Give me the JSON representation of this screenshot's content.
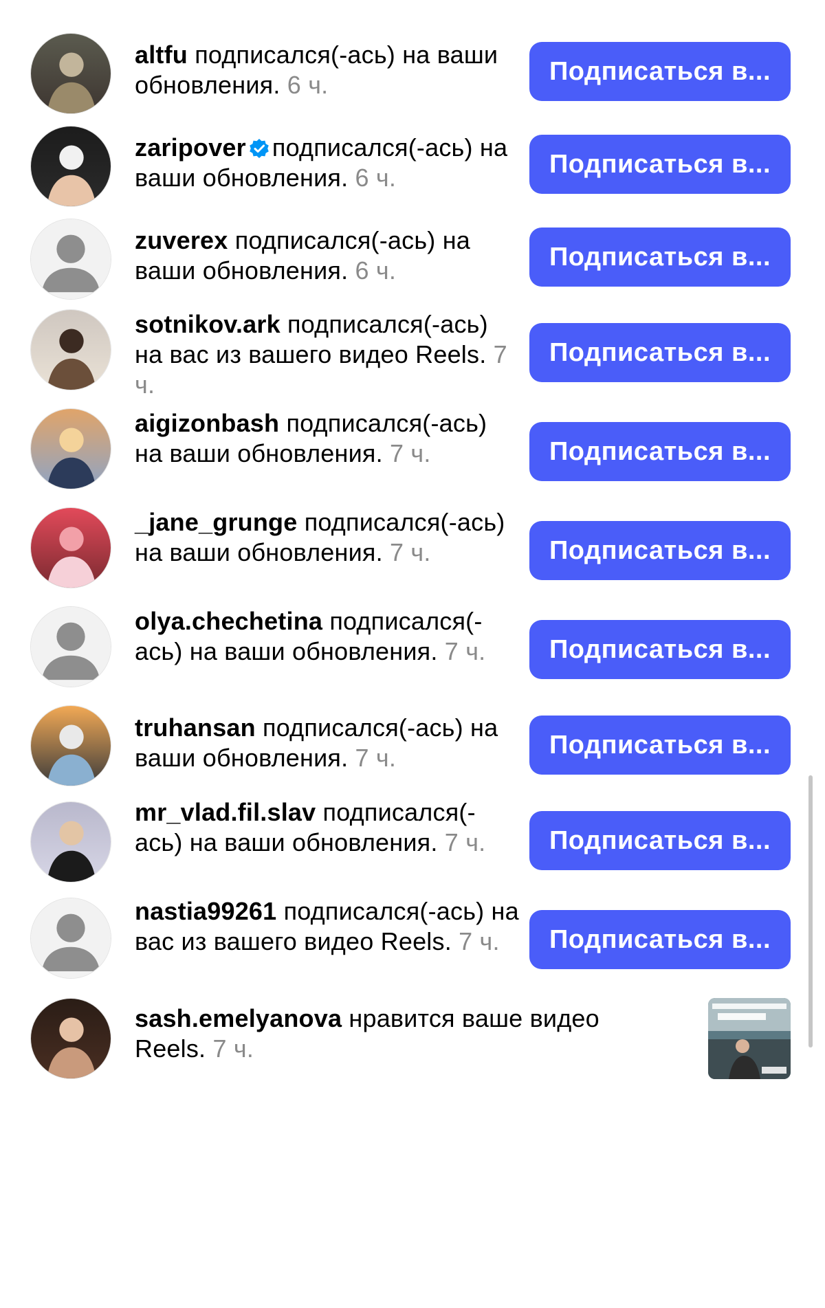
{
  "notifications": [
    {
      "username": "altfu",
      "action": "подписался(-ась) на ваши обновления.",
      "time": "6 ч.",
      "verified": false,
      "avatar": "photo",
      "button_label": "Подписаться в..."
    },
    {
      "username": "zaripover",
      "action": "подписался(-ась) на ваши обновления.",
      "time": "6 ч.",
      "verified": true,
      "avatar": "photo",
      "button_label": "Подписаться в..."
    },
    {
      "username": "zuverex",
      "action": "подписался(-ась) на ваши обновления.",
      "time": "6 ч.",
      "verified": false,
      "avatar": "default",
      "button_label": "Подписаться в..."
    },
    {
      "username": "sotnikov.ark",
      "action": "подписался(-ась) на вас из вашего видео Reels.",
      "time": "7 ч.",
      "verified": false,
      "avatar": "photo",
      "button_label": "Подписаться в..."
    },
    {
      "username": "aigizonbash",
      "action": "подписался(-ась) на ваши обновления.",
      "time": "7 ч.",
      "verified": false,
      "avatar": "photo",
      "button_label": "Подписаться в..."
    },
    {
      "username": "_jane_grunge",
      "action": "подписался(-ась) на ваши обновления.",
      "time": "7 ч.",
      "verified": false,
      "avatar": "photo",
      "button_label": "Подписаться в..."
    },
    {
      "username": "olya.chechetina",
      "action": "подписался(-ась) на ваши обновления.",
      "time": "7 ч.",
      "verified": false,
      "avatar": "default",
      "button_label": "Подписаться в..."
    },
    {
      "username": "truhansan",
      "action": "подписался(-ась) на ваши обновления.",
      "time": "7 ч.",
      "verified": false,
      "avatar": "photo",
      "button_label": "Подписаться в..."
    },
    {
      "username": "mr_vlad.fil.slav",
      "action": "подписался(-ась) на ваши обновления.",
      "time": "7 ч.",
      "verified": false,
      "avatar": "photo",
      "button_label": "Подписаться в..."
    },
    {
      "username": "nastia99261",
      "action": "подписался(-ась) на вас из вашего видео Reels.",
      "time": "7 ч.",
      "verified": false,
      "avatar": "default",
      "button_label": "Подписаться в..."
    },
    {
      "username": "sash.emelyanova",
      "action": "нравится ваше видео Reels.",
      "time": "7 ч.",
      "verified": false,
      "avatar": "photo",
      "thumbnail": true,
      "button_label": null
    }
  ],
  "colors": {
    "button": "#4a5df9",
    "button_text": "#ffffff",
    "time_text": "#8a8a8a",
    "verified_badge": "#0095f6"
  }
}
